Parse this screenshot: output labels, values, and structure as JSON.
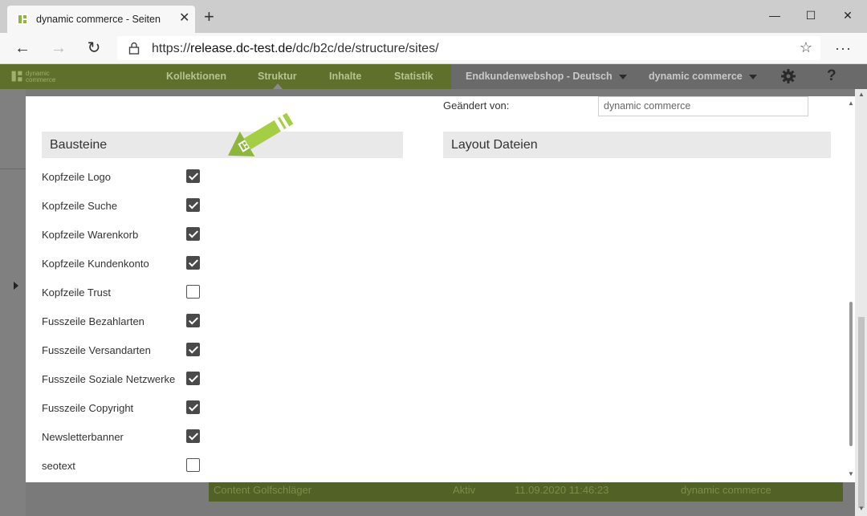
{
  "browser": {
    "tab_title": "dynamic commerce - Seiten",
    "new_tab": "+",
    "url_prefix": "https://",
    "url_host": "release.dc-test.de",
    "url_path": "/dc/b2c/de/structure/sites/"
  },
  "app": {
    "logo_text": "dynamic commerce",
    "nav": [
      "Kollektionen",
      "Struktur",
      "Inhalte",
      "Statistik"
    ],
    "shop_select": "Endkundenwebshop - Deutsch",
    "user_select": "dynamic commerce",
    "help": "?"
  },
  "background_row": {
    "name": "Content Golfschläger",
    "status": "Aktiv",
    "date": "11.09.2020 11:46:23",
    "user": "dynamic commerce"
  },
  "modal": {
    "changed_by_label": "Geändert von:",
    "changed_by_value": "dynamic commerce",
    "bausteine_title": "Bausteine",
    "layout_title": "Layout Dateien",
    "bausteine": [
      {
        "label": "Kopfzeile Logo",
        "checked": true
      },
      {
        "label": "Kopfzeile Suche",
        "checked": true
      },
      {
        "label": "Kopfzeile Warenkorb",
        "checked": true
      },
      {
        "label": "Kopfzeile Kundenkonto",
        "checked": true
      },
      {
        "label": "Kopfzeile Trust",
        "checked": false
      },
      {
        "label": "Fusszeile Bezahlarten",
        "checked": true
      },
      {
        "label": "Fusszeile Versandarten",
        "checked": true
      },
      {
        "label": "Fusszeile Soziale Netzwerke",
        "checked": true
      },
      {
        "label": "Fusszeile Copyright",
        "checked": true
      },
      {
        "label": "Newsletterbanner",
        "checked": true
      },
      {
        "label": "seotext",
        "checked": false
      }
    ]
  },
  "colors": {
    "brand_green": "#8db73c",
    "nav_green_dimmed": "#5f6f2c",
    "checkbox_checked": "#4a4a4a"
  },
  "icons": {
    "annotation": "green-pencil-arrow-icon"
  }
}
